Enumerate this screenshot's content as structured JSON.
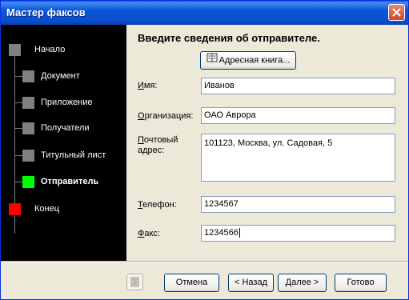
{
  "window": {
    "title": "Мастер факсов"
  },
  "steps": [
    {
      "label": "Начало",
      "color": "#808080"
    },
    {
      "label": "Документ",
      "color": "#808080"
    },
    {
      "label": "Приложение",
      "color": "#808080"
    },
    {
      "label": "Получатели",
      "color": "#808080"
    },
    {
      "label": "Титульный лист",
      "color": "#808080"
    },
    {
      "label": "Отправитель",
      "color": "#00FF00",
      "active": true
    },
    {
      "label": "Конец",
      "color": "#FF0000"
    }
  ],
  "main": {
    "heading": "Введите сведения об отправителе.",
    "address_book_label": "Адресная книга...",
    "name_label": "Имя:",
    "name_value": "Иванов",
    "org_label": "Организация:",
    "org_value": "ОАО Аврора",
    "address_label_line1": "Почтовый",
    "address_label_line2": "адрес:",
    "address_value": "101123, Москва, ул. Садовая, 5",
    "phone_label": "Телефон:",
    "phone_value": "1234567",
    "fax_label": "Факс:",
    "fax_value": "1234566"
  },
  "footer": {
    "cancel": "Отмена",
    "back": "< Назад",
    "next": "Далее >",
    "finish": "Готово"
  },
  "colors": {
    "titlebar": "#0A56D8",
    "accent_active": "#00FF00",
    "accent_end": "#FF0000"
  }
}
